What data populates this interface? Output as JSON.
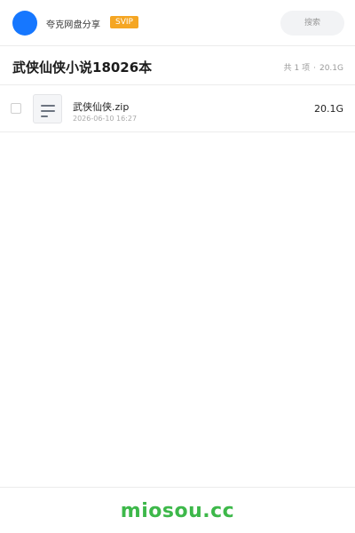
{
  "header": {
    "brand": "夸克网盘分享",
    "badge": "SVIP",
    "search_placeholder": "搜索"
  },
  "folder": {
    "title": "武侠仙侠小说18026本",
    "count_label": "共 1 项",
    "separator": "·",
    "total_size": "20.1G"
  },
  "files": [
    {
      "name": "武侠仙侠.zip",
      "time": "2026-06-10 16:27",
      "size": "20.1G",
      "icon": "document-icon"
    }
  ],
  "footer": {
    "site": "miosou.cc"
  },
  "colors": {
    "avatar": "#1677ff",
    "badge": "#f5a623",
    "footer_brand": "#3db84a"
  }
}
